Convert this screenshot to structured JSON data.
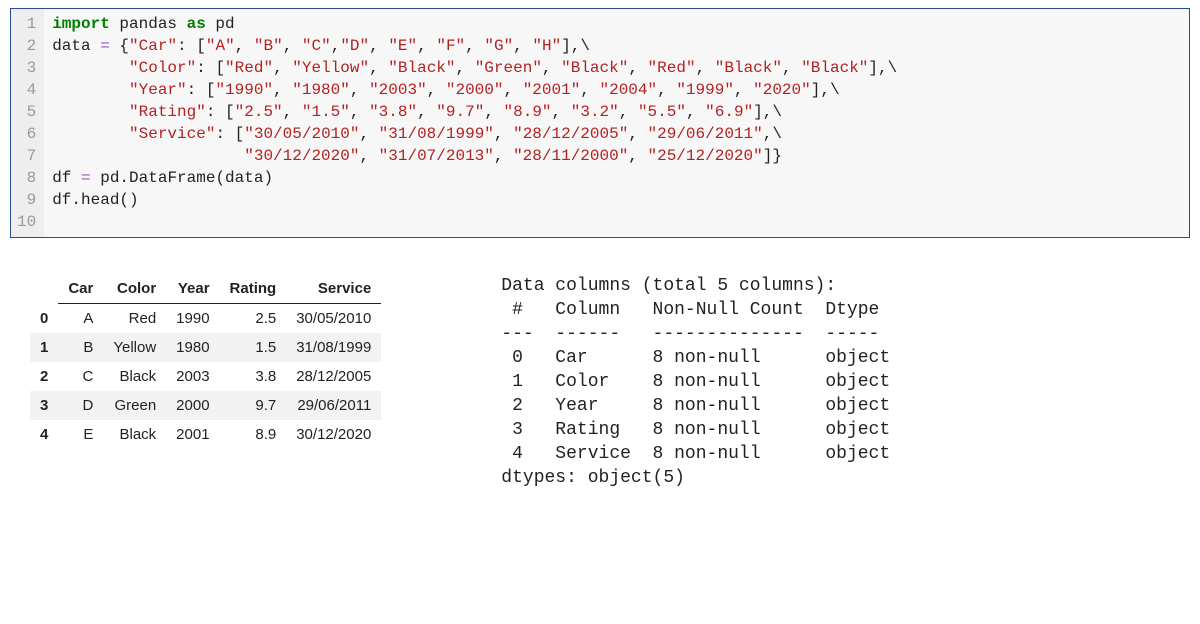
{
  "code": {
    "lines": [
      [
        {
          "t": "import",
          "c": "kw-green"
        },
        {
          "t": " pandas "
        },
        {
          "t": "as",
          "c": "kw-green"
        },
        {
          "t": " pd"
        }
      ],
      [
        {
          "t": ""
        }
      ],
      [
        {
          "t": "data "
        },
        {
          "t": "=",
          "c": "kw-purple"
        },
        {
          "t": " {"
        },
        {
          "t": "\"Car\"",
          "c": "str"
        },
        {
          "t": ": ["
        },
        {
          "t": "\"A\"",
          "c": "str"
        },
        {
          "t": ", "
        },
        {
          "t": "\"B\"",
          "c": "str"
        },
        {
          "t": ", "
        },
        {
          "t": "\"C\"",
          "c": "str"
        },
        {
          "t": ","
        },
        {
          "t": "\"D\"",
          "c": "str"
        },
        {
          "t": ", "
        },
        {
          "t": "\"E\"",
          "c": "str"
        },
        {
          "t": ", "
        },
        {
          "t": "\"F\"",
          "c": "str"
        },
        {
          "t": ", "
        },
        {
          "t": "\"G\"",
          "c": "str"
        },
        {
          "t": ", "
        },
        {
          "t": "\"H\"",
          "c": "str"
        },
        {
          "t": "],\\"
        }
      ],
      [
        {
          "t": "        "
        },
        {
          "t": "\"Color\"",
          "c": "str"
        },
        {
          "t": ": ["
        },
        {
          "t": "\"Red\"",
          "c": "str"
        },
        {
          "t": ", "
        },
        {
          "t": "\"Yellow\"",
          "c": "str"
        },
        {
          "t": ", "
        },
        {
          "t": "\"Black\"",
          "c": "str"
        },
        {
          "t": ", "
        },
        {
          "t": "\"Green\"",
          "c": "str"
        },
        {
          "t": ", "
        },
        {
          "t": "\"Black\"",
          "c": "str"
        },
        {
          "t": ", "
        },
        {
          "t": "\"Red\"",
          "c": "str"
        },
        {
          "t": ", "
        },
        {
          "t": "\"Black\"",
          "c": "str"
        },
        {
          "t": ", "
        },
        {
          "t": "\"Black\"",
          "c": "str"
        },
        {
          "t": "],\\"
        }
      ],
      [
        {
          "t": "        "
        },
        {
          "t": "\"Year\"",
          "c": "str"
        },
        {
          "t": ": ["
        },
        {
          "t": "\"1990\"",
          "c": "str"
        },
        {
          "t": ", "
        },
        {
          "t": "\"1980\"",
          "c": "str"
        },
        {
          "t": ", "
        },
        {
          "t": "\"2003\"",
          "c": "str"
        },
        {
          "t": ", "
        },
        {
          "t": "\"2000\"",
          "c": "str"
        },
        {
          "t": ", "
        },
        {
          "t": "\"2001\"",
          "c": "str"
        },
        {
          "t": ", "
        },
        {
          "t": "\"2004\"",
          "c": "str"
        },
        {
          "t": ", "
        },
        {
          "t": "\"1999\"",
          "c": "str"
        },
        {
          "t": ", "
        },
        {
          "t": "\"2020\"",
          "c": "str"
        },
        {
          "t": "],\\"
        }
      ],
      [
        {
          "t": "        "
        },
        {
          "t": "\"Rating\"",
          "c": "str"
        },
        {
          "t": ": ["
        },
        {
          "t": "\"2.5\"",
          "c": "str"
        },
        {
          "t": ", "
        },
        {
          "t": "\"1.5\"",
          "c": "str"
        },
        {
          "t": ", "
        },
        {
          "t": "\"3.8\"",
          "c": "str"
        },
        {
          "t": ", "
        },
        {
          "t": "\"9.7\"",
          "c": "str"
        },
        {
          "t": ", "
        },
        {
          "t": "\"8.9\"",
          "c": "str"
        },
        {
          "t": ", "
        },
        {
          "t": "\"3.2\"",
          "c": "str"
        },
        {
          "t": ", "
        },
        {
          "t": "\"5.5\"",
          "c": "str"
        },
        {
          "t": ", "
        },
        {
          "t": "\"6.9\"",
          "c": "str"
        },
        {
          "t": "],\\"
        }
      ],
      [
        {
          "t": "        "
        },
        {
          "t": "\"Service\"",
          "c": "str"
        },
        {
          "t": ": ["
        },
        {
          "t": "\"30/05/2010\"",
          "c": "str"
        },
        {
          "t": ", "
        },
        {
          "t": "\"31/08/1999\"",
          "c": "str"
        },
        {
          "t": ", "
        },
        {
          "t": "\"28/12/2005\"",
          "c": "str"
        },
        {
          "t": ", "
        },
        {
          "t": "\"29/06/2011\"",
          "c": "str"
        },
        {
          "t": ",\\"
        }
      ],
      [
        {
          "t": "                    "
        },
        {
          "t": "\"30/12/2020\"",
          "c": "str"
        },
        {
          "t": ", "
        },
        {
          "t": "\"31/07/2013\"",
          "c": "str"
        },
        {
          "t": ", "
        },
        {
          "t": "\"28/11/2000\"",
          "c": "str"
        },
        {
          "t": ", "
        },
        {
          "t": "\"25/12/2020\"",
          "c": "str"
        },
        {
          "t": "]}"
        }
      ],
      [
        {
          "t": "df "
        },
        {
          "t": "=",
          "c": "kw-purple"
        },
        {
          "t": " pd.DataFrame(data)"
        }
      ],
      [
        {
          "t": "df.head()"
        }
      ]
    ],
    "line_numbers": [
      "1",
      "2",
      "3",
      "4",
      "5",
      "6",
      "7",
      "8",
      "9",
      "10"
    ]
  },
  "dfhead": {
    "columns": [
      "",
      "Car",
      "Color",
      "Year",
      "Rating",
      "Service"
    ],
    "rows": [
      [
        "0",
        "A",
        "Red",
        "1990",
        "2.5",
        "30/05/2010"
      ],
      [
        "1",
        "B",
        "Yellow",
        "1980",
        "1.5",
        "31/08/1999"
      ],
      [
        "2",
        "C",
        "Black",
        "2003",
        "3.8",
        "28/12/2005"
      ],
      [
        "3",
        "D",
        "Green",
        "2000",
        "9.7",
        "29/06/2011"
      ],
      [
        "4",
        "E",
        "Black",
        "2001",
        "8.9",
        "30/12/2020"
      ]
    ]
  },
  "info": {
    "header": "Data columns (total 5 columns):",
    "colhdr": " #   Column   Non-Null Count  Dtype",
    "sep": "---  ------   --------------  -----",
    "rows": [
      " 0   Car      8 non-null      object",
      " 1   Color    8 non-null      object",
      " 2   Year     8 non-null      object",
      " 3   Rating   8 non-null      object",
      " 4   Service  8 non-null      object"
    ],
    "footer": "dtypes: object(5)"
  }
}
